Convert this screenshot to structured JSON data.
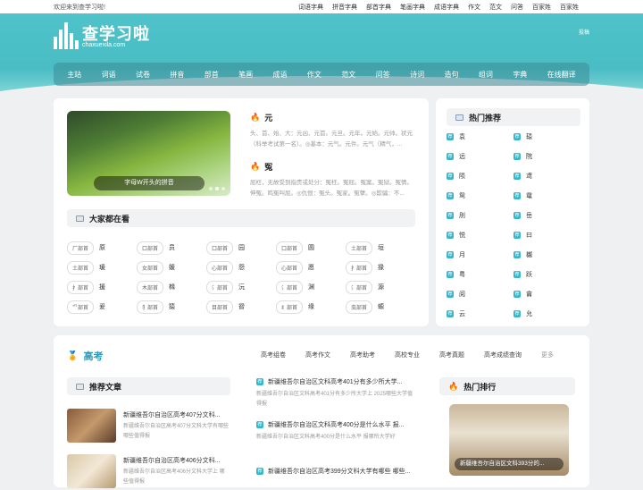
{
  "topbar": {
    "welcome": "欢迎来到查学习啦!",
    "links": [
      "词语字典",
      "拼音字典",
      "部首字典",
      "笔画字典",
      "成语字典",
      "作文",
      "范文",
      "问答",
      "百家姓",
      "百家姓"
    ]
  },
  "header": {
    "logo_name": "查学习啦",
    "logo_domain": "chaxuexila.com",
    "tougao": "投稿"
  },
  "nav": [
    "主站",
    "词语",
    "试卷",
    "拼音",
    "部首",
    "笔画",
    "成语",
    "作文",
    "范文",
    "问答",
    "诗词",
    "造句",
    "组词",
    "字典",
    "在线翻译"
  ],
  "slider": {
    "caption": "字母W开头的拼音"
  },
  "featured_words": [
    {
      "word": "元",
      "desc": "头、首、始、大：元凶、元首。元旦。元年。元始。元帅。状元（科举考试第一名）。◎基本：元气。元件。元气（精气，..."
    },
    {
      "word": "冤",
      "desc": "屈枉，无故受到指责或处分：冤枉。冤屈。冤案。冤狱。冤情。伸冤。鸣冤叫屈。◎仇恨：冤头。冤家。冤孽。◎欺骗：不..."
    }
  ],
  "popular_section": {
    "title": "大家都在看",
    "rows": [
      [
        {
          "tag": "厂部首",
          "ch": "原"
        },
        {
          "tag": "口部首",
          "ch": "员"
        },
        {
          "tag": "口部首",
          "ch": "园"
        },
        {
          "tag": "口部首",
          "ch": "圆"
        },
        {
          "tag": "土部首",
          "ch": "垣"
        }
      ],
      [
        {
          "tag": "土部首",
          "ch": "瑗"
        },
        {
          "tag": "女部首",
          "ch": "媛"
        },
        {
          "tag": "心部首",
          "ch": "怨"
        },
        {
          "tag": "心部首",
          "ch": "愿"
        },
        {
          "tag": "扌部首",
          "ch": "掾"
        }
      ],
      [
        {
          "tag": "扌部首",
          "ch": "援"
        },
        {
          "tag": "木部首",
          "ch": "橼"
        },
        {
          "tag": "氵部首",
          "ch": "沅"
        },
        {
          "tag": "氵部首",
          "ch": "渊"
        },
        {
          "tag": "氵部首",
          "ch": "源"
        }
      ],
      [
        {
          "tag": "爫部首",
          "ch": "爰"
        },
        {
          "tag": "犭部首",
          "ch": "猿"
        },
        {
          "tag": "目部首",
          "ch": "眢"
        },
        {
          "tag": "纟部首",
          "ch": "缘"
        },
        {
          "tag": "虫部首",
          "ch": "螈"
        }
      ]
    ]
  },
  "hot_recommend": {
    "title": "热门推荐",
    "rows": [
      [
        "袁",
        "辕"
      ],
      [
        "远",
        "院"
      ],
      [
        "陨",
        "鸢"
      ],
      [
        "鸳",
        "鼋"
      ],
      [
        "刖",
        "岳"
      ],
      [
        "悦",
        "曰"
      ],
      [
        "月",
        "樾"
      ],
      [
        "粤",
        "跃"
      ],
      [
        "阅",
        "龠"
      ],
      [
        "云",
        "允"
      ]
    ]
  },
  "gaokao": {
    "title": "高考",
    "tabs": [
      "高考组卷",
      "高考作文",
      "高考助考",
      "高校专业",
      "高考真题",
      "高考成绩查询",
      "更多"
    ],
    "recommend_title": "推荐文章",
    "articles": [
      {
        "title": "新疆维吾尔自治区高考407分文科...",
        "desc": "新疆维吾尔自治区高考407分文科大学有哪些 哪些值得报"
      },
      {
        "title": "新疆维吾尔自治区高考406分文科...",
        "desc": "新疆维吾尔自治区高考406分文科大学上 哪些值得报"
      }
    ],
    "news": [
      {
        "title": "新疆维吾尔自治区文科高考401分有多少所大学...",
        "desc": "新疆维吾尔自治区文科高考401分有多少所大学上 2025哪些大学值得报"
      },
      {
        "title": "新疆维吾尔自治区文科高考400分是什么水平 报...",
        "desc": "新疆维吾尔自治区文科高考400分是什么水平 报哪所大学好"
      },
      {
        "title": "新疆维吾尔自治区高考399分文科大学有哪些 哪些...",
        "desc": ""
      }
    ],
    "rank_title": "热门排行",
    "rank_caption": "新疆维吾尔自治区文科393分的..."
  }
}
